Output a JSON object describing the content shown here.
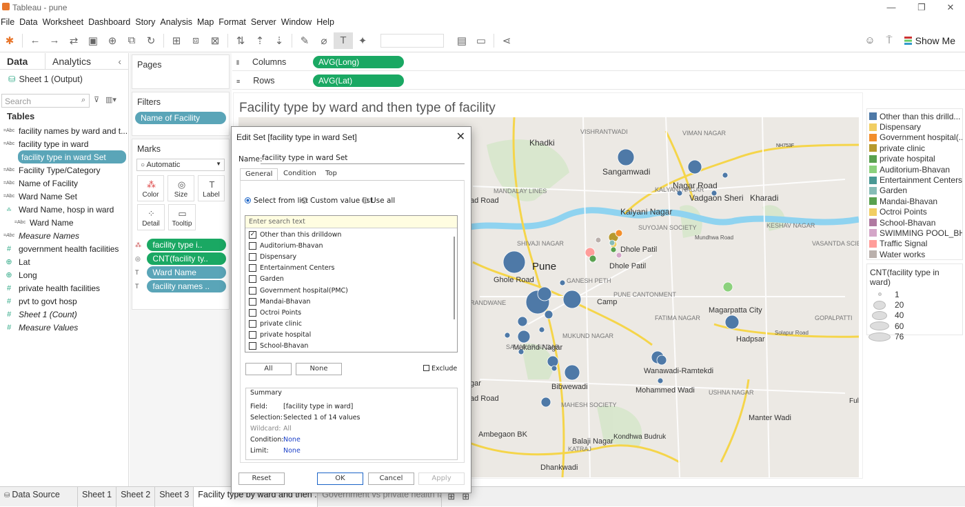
{
  "window": {
    "title": "Tableau - pune"
  },
  "menu": [
    "File",
    "Data",
    "Worksheet",
    "Dashboard",
    "Story",
    "Analysis",
    "Map",
    "Format",
    "Server",
    "Window",
    "Help"
  ],
  "toolbar": {
    "show_me": "Show Me"
  },
  "datapane": {
    "tab_data": "Data",
    "tab_analytics": "Analytics",
    "source": "Sheet 1 (Output)",
    "search_placeholder": "Search",
    "tables_header": "Tables",
    "fields": [
      {
        "icon": "Abc",
        "label": "facility names by ward and t..."
      },
      {
        "icon": "Abc",
        "label": "facility type in ward"
      },
      {
        "icon": "set",
        "label": "facility type in ward Set",
        "selected": true
      },
      {
        "icon": "Abc",
        "label": "Facility Type/Category"
      },
      {
        "icon": "Abc",
        "label": "Name of Facility"
      },
      {
        "icon": "Abc",
        "label": "Ward Name Set"
      },
      {
        "icon": "hier",
        "label": "Ward Name, hosp in ward"
      },
      {
        "icon": "Abc",
        "label": "Ward Name",
        "indent": true
      },
      {
        "icon": "Abc",
        "label": "Measure Names",
        "italic": true
      },
      {
        "icon": "#",
        "label": "government health facilities"
      },
      {
        "icon": "geo",
        "label": "Lat"
      },
      {
        "icon": "geo",
        "label": "Long"
      },
      {
        "icon": "#",
        "label": "private health facilities"
      },
      {
        "icon": "#",
        "label": "pvt to govt hosp"
      },
      {
        "icon": "#",
        "label": "Sheet 1 (Count)",
        "italic": true
      },
      {
        "icon": "#",
        "label": "Measure Values",
        "italic": true
      }
    ]
  },
  "pages": {
    "title": "Pages"
  },
  "filters": {
    "title": "Filters",
    "items": [
      "Name of Facility"
    ]
  },
  "marks": {
    "title": "Marks",
    "type": "Automatic",
    "buttons": [
      "Color",
      "Size",
      "Label",
      "Detail",
      "Tooltip"
    ],
    "pills": [
      "facility type i..",
      "CNT(facility ty..",
      "Ward Name",
      "facility names .."
    ]
  },
  "columns": {
    "label": "Columns",
    "pill": "AVG(Long)"
  },
  "rows": {
    "label": "Rows",
    "pill": "AVG(Lat)"
  },
  "viz": {
    "title": "Facility type by ward and then type of facility",
    "map_labels": [
      "Khadki",
      "Sangamwadi",
      "Nagar Road",
      "Vadgaon Sheri",
      "Kharadi",
      "Kalyani Nagar",
      "Pune",
      "Ghole Road",
      "Dhole Patil",
      "Dhole Patil",
      "Camp",
      "Magarpatta City",
      "Hadpsar",
      "Mukund Nagar",
      "Wanawadi-Ramtekdi",
      "Mohammed Wadi",
      "Bibwewadi",
      "Manter Wadi",
      "Ambegaon BK",
      "Balaji Nagar",
      "Kondhwa Budruk",
      "Dhankwadi",
      "ad Road",
      "ad Road",
      "gar",
      "VISHRANTWADI",
      "VIMAN NAGAR",
      "MANDALAY LINES",
      "KALYANI NAGAR",
      "SHIVAJI NAGAR",
      "GANESH PETH",
      "SUYOJAN SOCIETY",
      "KESHAV NAGAR",
      "VASANTDA SCIENCE INSTITUTE",
      "GOPALPATTI",
      "RANDWANE",
      "FATIMA NAGAR",
      "SAHAKAR NAGAR",
      "MUKUND NAGAR",
      "MAHESH SOCIETY",
      "USHNA NAGAR",
      "KATRAJ",
      "Mundhwa Road",
      "Solapur Road",
      "NH753F",
      "PUNE CANTONMENT",
      "Ful"
    ]
  },
  "legend_color": {
    "items": [
      {
        "label": "Other than this drilld...",
        "color": "#4e79a7"
      },
      {
        "label": "Dispensary",
        "color": "#f1ce63"
      },
      {
        "label": "Government hospital(...",
        "color": "#f28e2b"
      },
      {
        "label": "private clinic",
        "color": "#b6992d"
      },
      {
        "label": "private hospital",
        "color": "#59a14f"
      },
      {
        "label": "Auditorium-Bhavan",
        "color": "#8cd17d"
      },
      {
        "label": "Entertainment Centers",
        "color": "#499894"
      },
      {
        "label": "Garden",
        "color": "#86bcb6"
      },
      {
        "label": "Mandai-Bhavan",
        "color": "#59a14f"
      },
      {
        "label": "Octroi Points",
        "color": "#f1ce63"
      },
      {
        "label": "School-Bhavan",
        "color": "#b07aa1"
      },
      {
        "label": "SWIMMING POOL_BH..",
        "color": "#d4a6c8"
      },
      {
        "label": "Traffic Signal",
        "color": "#ff9d9a"
      },
      {
        "label": "Water works",
        "color": "#bab0ac"
      }
    ]
  },
  "legend_size": {
    "title": "CNT(facility type in ward)",
    "items": [
      "1",
      "20",
      "40",
      "60",
      "76"
    ]
  },
  "tabs": [
    "Data Source",
    "Sheet 1",
    "Sheet 2",
    "Sheet 3",
    "Facility type by ward and then ...",
    "Government vs private health fa..."
  ],
  "dialog": {
    "title": "Edit Set [facility type in ward Set]",
    "name_label": "Name:",
    "name_value": "facility type in ward Set",
    "tabs": [
      "General",
      "Condition",
      "Top"
    ],
    "radios": [
      "Select from list",
      "Custom value list",
      "Use all"
    ],
    "search_placeholder": "Enter search text",
    "list": [
      {
        "label": "Other than this drilldown",
        "checked": true
      },
      {
        "label": "Auditorium-Bhavan",
        "checked": false
      },
      {
        "label": "Dispensary",
        "checked": false
      },
      {
        "label": "Entertainment Centers",
        "checked": false
      },
      {
        "label": "Garden",
        "checked": false
      },
      {
        "label": "Government hospital(PMC)",
        "checked": false
      },
      {
        "label": "Mandai-Bhavan",
        "checked": false
      },
      {
        "label": "Octroi Points",
        "checked": false
      },
      {
        "label": "private clinic",
        "checked": false
      },
      {
        "label": "private hospital",
        "checked": false
      },
      {
        "label": "School-Bhavan",
        "checked": false
      }
    ],
    "btn_all": "All",
    "btn_none": "None",
    "exclude": "Exclude",
    "summary": {
      "title": "Summary",
      "field_l": "Field:",
      "field_v": "[facility type in ward]",
      "selection_l": "Selection:",
      "selection_v": "Selected 1 of 14 values",
      "wildcard_l": "Wildcard:",
      "wildcard_v": "All",
      "condition_l": "Condition:",
      "condition_v": "None",
      "limit_l": "Limit:",
      "limit_v": "None"
    },
    "btn_reset": "Reset",
    "btn_ok": "OK",
    "btn_cancel": "Cancel",
    "btn_apply": "Apply"
  }
}
